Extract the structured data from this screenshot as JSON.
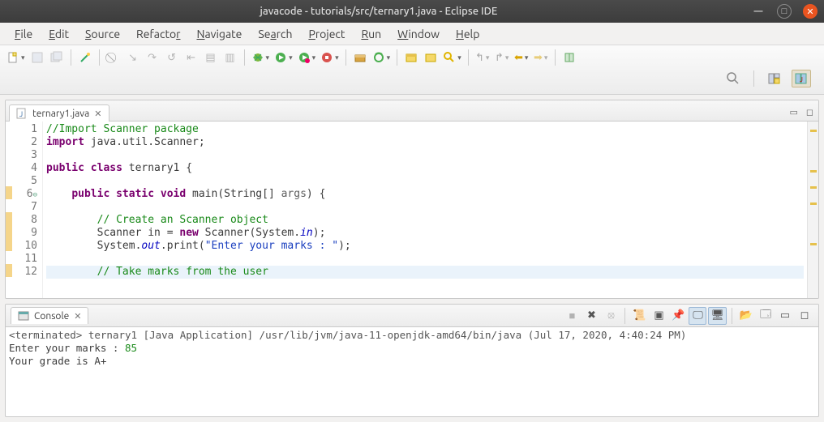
{
  "window": {
    "title": "javacode - tutorials/src/ternary1.java - Eclipse IDE"
  },
  "menu": {
    "items": [
      "File",
      "Edit",
      "Source",
      "Refactor",
      "Navigate",
      "Search",
      "Project",
      "Run",
      "Window",
      "Help"
    ],
    "underline_index": [
      0,
      0,
      0,
      7,
      0,
      2,
      0,
      0,
      0,
      0
    ]
  },
  "editor_tab": {
    "icon": "java-file-icon",
    "label": "ternary1.java"
  },
  "code": {
    "lines": [
      {
        "n": 1,
        "seg": [
          {
            "c": "k-comment",
            "t": "//Import Scanner package"
          }
        ]
      },
      {
        "n": 2,
        "seg": [
          {
            "c": "k-key",
            "t": "import"
          },
          {
            "c": "",
            "t": " java.util.Scanner;"
          }
        ]
      },
      {
        "n": 3,
        "seg": [
          {
            "c": "",
            "t": ""
          }
        ]
      },
      {
        "n": 4,
        "seg": [
          {
            "c": "k-key",
            "t": "public class"
          },
          {
            "c": "",
            "t": " ternary1 {"
          }
        ]
      },
      {
        "n": 5,
        "seg": [
          {
            "c": "",
            "t": ""
          }
        ]
      },
      {
        "n": 6,
        "seg": [
          {
            "c": "",
            "t": "    "
          },
          {
            "c": "k-key",
            "t": "public static void"
          },
          {
            "c": "",
            "t": " main(String[] "
          },
          {
            "c": "k-param",
            "t": "args"
          },
          {
            "c": "",
            "t": ") {"
          }
        ]
      },
      {
        "n": 7,
        "seg": [
          {
            "c": "",
            "t": ""
          }
        ]
      },
      {
        "n": 8,
        "seg": [
          {
            "c": "",
            "t": "        "
          },
          {
            "c": "k-comment",
            "t": "// Create an Scanner object"
          }
        ]
      },
      {
        "n": 9,
        "seg": [
          {
            "c": "",
            "t": "        Scanner in = "
          },
          {
            "c": "k-key",
            "t": "new"
          },
          {
            "c": "",
            "t": " Scanner(System."
          },
          {
            "c": "k-field",
            "t": "in"
          },
          {
            "c": "",
            "t": ");"
          }
        ]
      },
      {
        "n": 10,
        "seg": [
          {
            "c": "",
            "t": "        System."
          },
          {
            "c": "k-field",
            "t": "out"
          },
          {
            "c": "",
            "t": ".print("
          },
          {
            "c": "k-str",
            "t": "\"Enter your marks : \""
          },
          {
            "c": "",
            "t": ");"
          }
        ]
      },
      {
        "n": 11,
        "seg": [
          {
            "c": "",
            "t": ""
          }
        ]
      },
      {
        "n": 12,
        "hl": true,
        "seg": [
          {
            "c": "",
            "t": "        "
          },
          {
            "c": "k-comment",
            "t": "// Take marks from the user"
          }
        ]
      }
    ],
    "warn_lines": [
      6,
      8,
      9,
      10,
      12
    ]
  },
  "console_tab": {
    "label": "Console"
  },
  "console": {
    "header_prefix": "<terminated> ",
    "header": "ternary1 [Java Application] /usr/lib/jvm/java-11-openjdk-amd64/bin/java (Jul 17, 2020, 4:40:24 PM)",
    "line1_prefix": "Enter your marks : ",
    "line1_input": "85",
    "line2": "Your grade is A+"
  },
  "toolbar_icons": {
    "new": "new-file-icon",
    "save": "save-icon",
    "saveall": "save-all-icon",
    "wand": "wand-icon",
    "undo": "undo-icon",
    "redo": "redo-icon",
    "debug": "debug-icon",
    "run": "run-icon",
    "runext": "run-ext-icon",
    "stop": "stop-icon",
    "pkg": "package-icon",
    "refresh": "refresh-icon",
    "folder": "open-folder-icon",
    "folder2": "folder-icon",
    "search": "search-icon",
    "back": "back-icon",
    "fwd": "forward-icon",
    "magnifier": "magnifier-icon",
    "persp1": "perspective-java-icon",
    "persp2": "perspective-debug-icon"
  },
  "console_tools": [
    "terminate-icon",
    "remove-icon",
    "remove-all-icon",
    "sep",
    "scroll-lock-icon",
    "show-console-icon",
    "pin-icon",
    "display-icon",
    "display2-icon",
    "sep",
    "open-console-icon",
    "new-console-icon",
    "min-icon",
    "max-icon"
  ]
}
